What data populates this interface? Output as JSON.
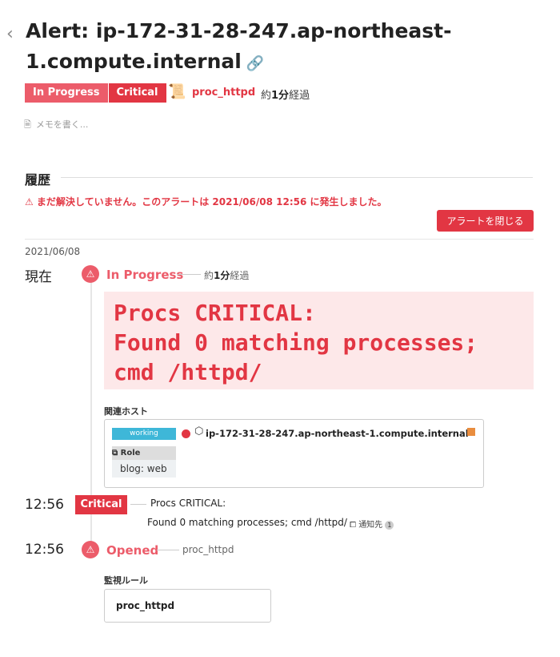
{
  "header": {
    "title": "Alert: ip-172-31-28-247.ap-northeast-1.compute.internal",
    "back_icon": "chevron-left-icon",
    "link_icon": "link-icon"
  },
  "badges": {
    "status": "In Progress",
    "severity": "Critical"
  },
  "monitor": {
    "name": "proc_httpd",
    "icon": "monitor-scroll-icon"
  },
  "elapsed": {
    "prefix": "約",
    "value": "1分",
    "suffix": "経過"
  },
  "memo": {
    "placeholder": "メモを書く..."
  },
  "history": {
    "heading": "履歴",
    "warning": "⚠ まだ解決していません。このアラートは 2021/06/08 12:56 に発生しました。",
    "close_button": "アラートを閉じる",
    "date": "2021/06/08"
  },
  "timeline": {
    "current": {
      "time": "現在",
      "status": "In Progress",
      "elapsed_prefix": "約",
      "elapsed_value": "1分",
      "elapsed_suffix": "経過",
      "message_line1": "Procs CRITICAL:",
      "message_line2": "Found 0 matching processes;",
      "message_line3": "cmd /httpd/",
      "related_host_heading": "関連ホスト",
      "host_status": "working",
      "host_name": "ip-172-31-28-247.ap-northeast-1.compute.internal",
      "role_label": "Role",
      "role_value": "blog: web"
    },
    "critical": {
      "time": "12:56",
      "badge": "Critical",
      "line1": "Procs CRITICAL:",
      "line2": "Found 0 matching processes; cmd /httpd/",
      "notify_label": "通知先",
      "notify_count": "1"
    },
    "opened": {
      "time": "12:56",
      "status": "Opened",
      "monitor": "proc_httpd",
      "rule_heading": "監視ルール",
      "rule_name": "proc_httpd"
    }
  },
  "colors": {
    "accent_red": "#e23643",
    "soft_red": "#ec5c6a",
    "working_blue": "#3eb7d8",
    "orange": "#e98d3e"
  }
}
